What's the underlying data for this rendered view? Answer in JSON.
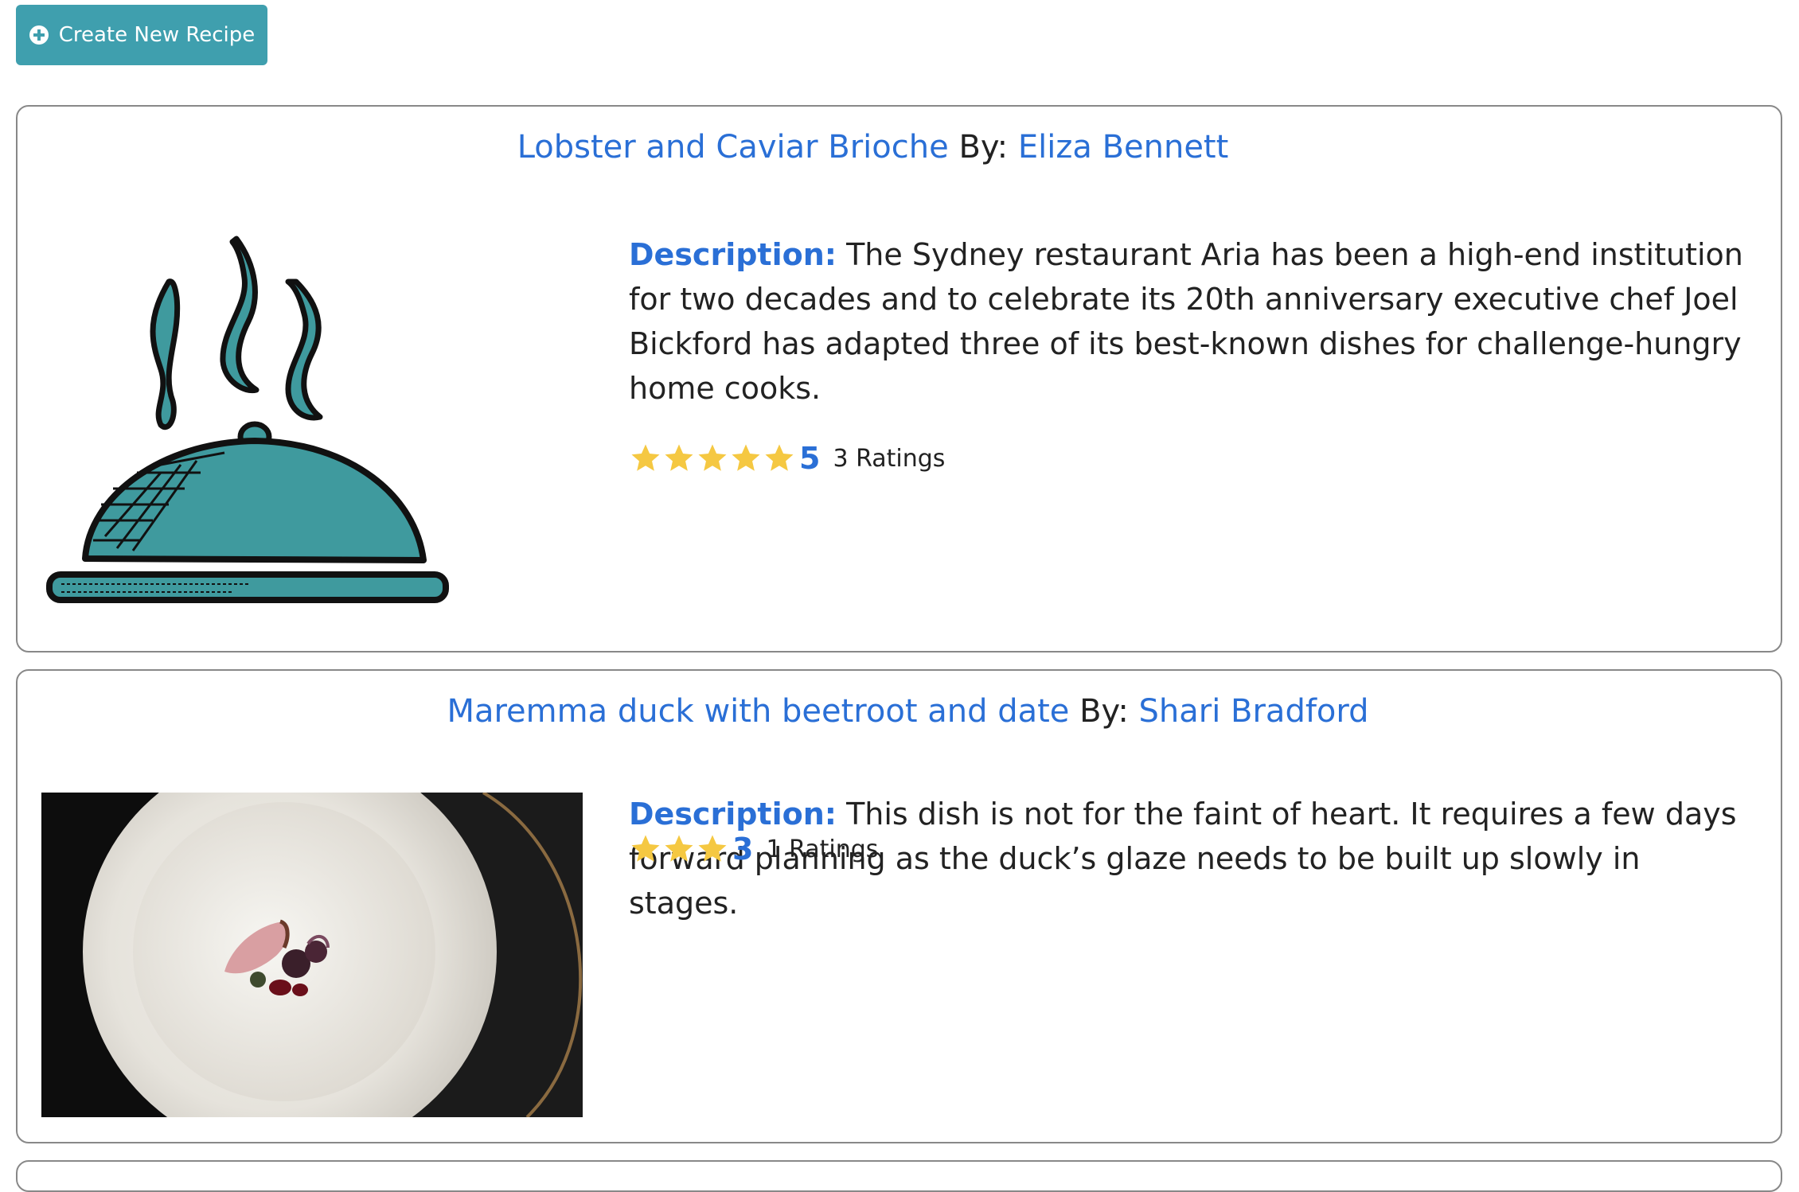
{
  "toolbar": {
    "create_label": "Create New Recipe",
    "create_icon": "plus-circle-icon",
    "button_color": "#3f9fae"
  },
  "recipes": [
    {
      "title": "Lobster and Caviar Brioche",
      "by_label": "By:",
      "author": "Eliza Bennett",
      "image": "serving-cloche-illustration",
      "description_label": "Description:",
      "description": "The Sydney restaurant Aria has been a high-end institution for two decades and to celebrate its 20th anniversary executive chef Joel Bickford has adapted three of its best-known dishes for challenge-hungry home cooks.",
      "stars": 5,
      "rating": "5",
      "ratings_count": "3 Ratings"
    },
    {
      "title": "Maremma duck with beetroot and date",
      "by_label": "By:",
      "author": "Shari Bradford",
      "image": "duck-dish-photo",
      "description_label": "Description:",
      "description": "This dish is not for the faint of heart. It requires a few days forward planning as the duck’s glaze needs to be built up slowly in stages.",
      "stars": 3,
      "rating": "3",
      "ratings_count": "1 Ratings"
    }
  ],
  "colors": {
    "link": "#2a6fd6",
    "star": "#f5c842",
    "cloche": "#3f9a9e"
  }
}
